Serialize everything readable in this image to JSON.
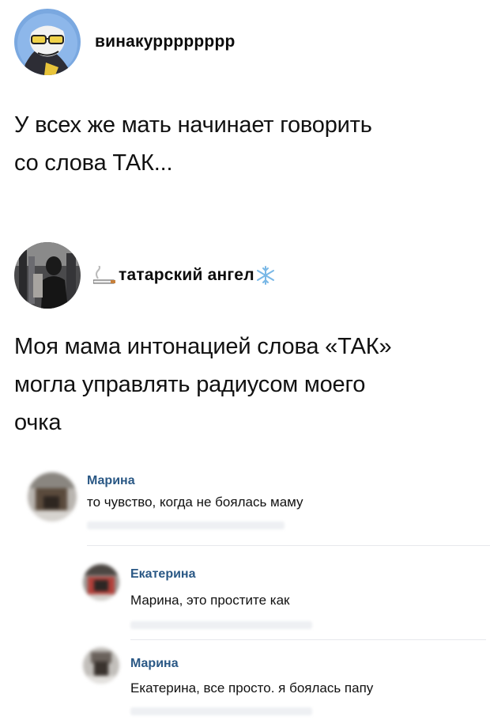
{
  "posts": [
    {
      "username": "винакурррррррр",
      "lines": [
        "У всех же мать начинает говорить",
        "со слова ТАК..."
      ]
    },
    {
      "username_prefix_emoji": "smoking-icon",
      "username": "татарский ангел",
      "username_suffix_emoji": "snowflake-icon",
      "lines": [
        "Моя мама интонацией слова «ТАК»",
        "могла управлять радиусом моего",
        "очка"
      ]
    }
  ],
  "comments": [
    {
      "author": "Марина",
      "text": "то чувство, когда не боялась маму"
    },
    {
      "author": "Екатерина",
      "text": "Марина, это простите как"
    },
    {
      "author": "Марина",
      "text": "Екатерина, все просто. я боялась папу"
    }
  ],
  "colors": {
    "comment_author": "#2a5885",
    "text": "#111111"
  }
}
